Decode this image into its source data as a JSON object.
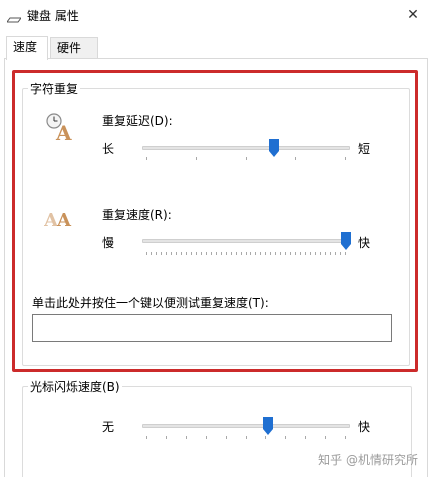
{
  "window": {
    "title": "键盘 属性",
    "close_glyph": "✕"
  },
  "tabs": [
    {
      "label": "速度",
      "selected": true
    },
    {
      "label": "硬件",
      "selected": false
    }
  ],
  "character_repeat": {
    "group_label": "字符重复",
    "repeat_delay": {
      "label": "重复延迟(D):",
      "min_label": "长",
      "max_label": "短",
      "value_fraction": 0.64
    },
    "repeat_rate": {
      "label": "重复速度(R):",
      "min_label": "慢",
      "max_label": "快",
      "value_fraction": 1.0
    },
    "test_prompt": "单击此处并按住一个键以便测试重复速度(T):",
    "test_value": ""
  },
  "cursor_blink": {
    "group_label": "光标闪烁速度(B)",
    "min_label": "无",
    "max_label": "快",
    "value_fraction": 0.61
  },
  "watermark": "知乎 @机情研究所",
  "colors": {
    "highlight_box": "#cc2b2b",
    "slider_thumb": "#1f6fd1",
    "icon_letter": "#c9925a"
  },
  "icons": {
    "window": "keyboard-icon",
    "repeat_delay": "delay-clock-icon",
    "repeat_rate": "repeat-letters-icon"
  }
}
